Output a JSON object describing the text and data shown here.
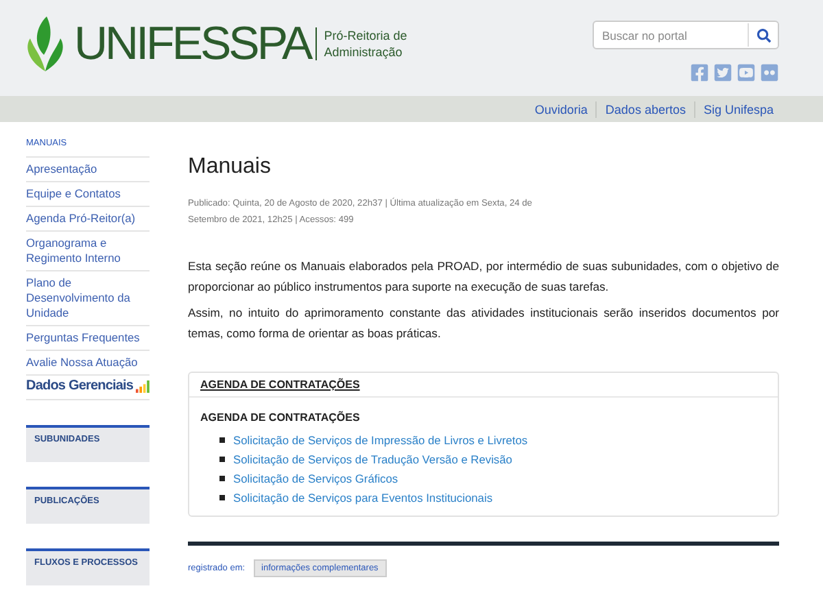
{
  "header": {
    "logo_text": "UNIFESSPA",
    "unit_name": [
      "Pró-Reitoria de",
      "Administração"
    ],
    "search": {
      "placeholder": "Buscar no portal"
    },
    "social": [
      {
        "kind": "facebook"
      },
      {
        "kind": "twitter"
      },
      {
        "kind": "youtube"
      },
      {
        "kind": "flickr"
      }
    ]
  },
  "top_links": [
    "Ouvidoria",
    "Dados abertos",
    "Sig Unifespa"
  ],
  "sidebar": {
    "heading": "MANUAIS",
    "items": [
      {
        "label": "Apresentação"
      },
      {
        "label": "Equipe e Contatos"
      },
      {
        "label": "Agenda Pró-Reitor(a)"
      },
      {
        "label": "Organograma e Regimento Interno"
      },
      {
        "label": "Plano de Desenvolvimento da Unidade"
      },
      {
        "label": "Perguntas Frequentes"
      },
      {
        "label": "Avalie Nossa Atuação"
      }
    ],
    "banner": "Dados Gerenciais",
    "sections": [
      "SUBUNIDADES",
      "PUBLICAÇÕES",
      "FLUXOS E PROCESSOS"
    ]
  },
  "article": {
    "title": "Manuais",
    "meta": "Publicado: Quinta, 20 de Agosto de 2020, 22h37 | Última atualização em Sexta, 24 de Setembro de 2021, 12h25 | Acessos: 499",
    "paragraphs": [
      "Esta seção reúne os Manuais elaborados pela PROAD, por intermédio de suas subunidades, com o objetivo de proporcionar ao público instrumentos para suporte na execução de suas tarefas.",
      "Assim, no intuito do aprimoramento constante das atividades institucionais serão inseridos documentos por temas, como forma de orientar as boas práticas."
    ],
    "panel": {
      "tab": "AGENDA DE CONTRATAÇÕES",
      "heading": "AGENDA DE CONTRATAÇÕES",
      "links": [
        "Solicitação de Serviços de Impressão de Livros e Livretos",
        "Solicitação de Serviços de Tradução Versão e Revisão",
        "Solicitação de Serviços Gráficos",
        "Solicitação de Serviços para Eventos Institucionais"
      ]
    }
  },
  "footer": {
    "label": "registrado em:",
    "tag": "informações complementares"
  }
}
